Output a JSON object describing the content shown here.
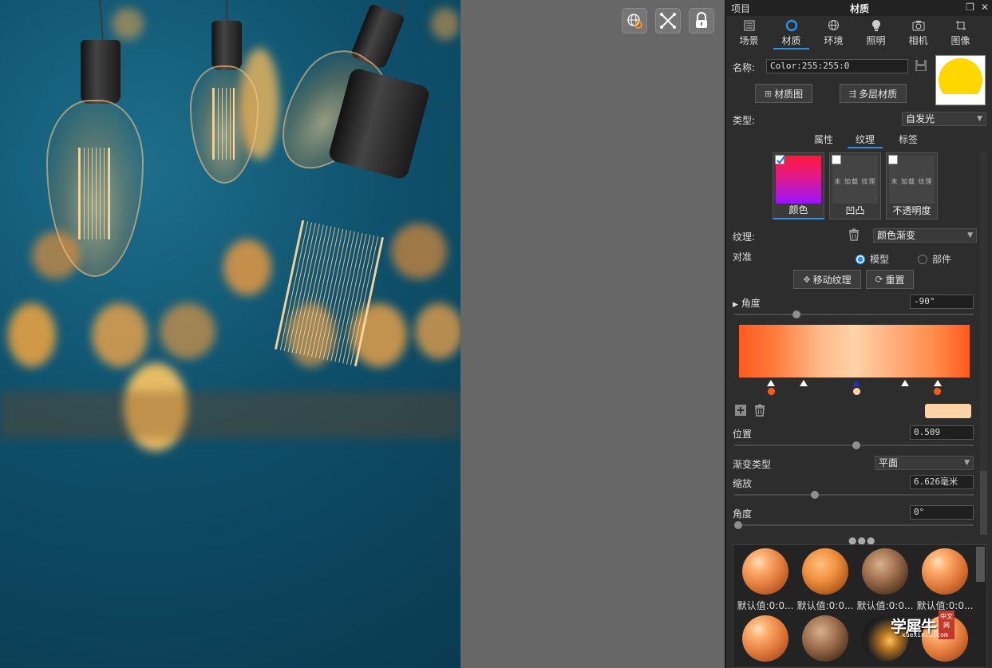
{
  "panel": {
    "project_label": "项目",
    "title": "材质",
    "tabs": [
      {
        "label": "场景",
        "icon": "scene-icon"
      },
      {
        "label": "材质",
        "icon": "material-icon"
      },
      {
        "label": "环境",
        "icon": "environment-icon"
      },
      {
        "label": "照明",
        "icon": "lighting-icon"
      },
      {
        "label": "相机",
        "icon": "camera-icon"
      },
      {
        "label": "图像",
        "icon": "image-icon"
      }
    ],
    "active_tab": "材质"
  },
  "material": {
    "name_label": "名称:",
    "name_value": "Color:255:255:0",
    "preview_color": "#ffd700",
    "graph_button": "材质图",
    "multilayer_button": "多层材质",
    "type_label": "类型:",
    "type_value": "自发光"
  },
  "sub_tabs": [
    "属性",
    "纹理",
    "标签"
  ],
  "active_sub_tab": "纹理",
  "texture_slots": [
    {
      "label": "颜色",
      "checked": true,
      "empty_text": ""
    },
    {
      "label": "凹凸",
      "checked": false,
      "empty_text": "未 加载 纹理"
    },
    {
      "label": "不透明度",
      "checked": false,
      "empty_text": "未 加载 纹理"
    }
  ],
  "texture": {
    "label": "纹理:",
    "value": "颜色渐变",
    "align_label": "对准",
    "align_options": [
      "模型",
      "部件"
    ],
    "align_selected": "模型",
    "move_button": "移动纹理",
    "reset_button": "重置",
    "angle_label": "角度",
    "angle_value": "-90°",
    "angle_slider": 0.25
  },
  "gradient": {
    "stops": [
      {
        "position": 0.14,
        "color": "#ff5a1e"
      },
      {
        "position": 0.509,
        "color": "#ffd3a6",
        "selected": true
      },
      {
        "position": 0.86,
        "color": "#ff5a1e"
      }
    ],
    "midpoints": [
      0.28,
      0.72
    ],
    "selected_color": "#ffd3a6",
    "position_label": "位置",
    "position_value": "0.509",
    "type_label": "渐变类型",
    "type_value": "平面",
    "scale_label": "缩放",
    "scale_value": "6.626毫米",
    "scale_slider": 0.33,
    "angle_label": "角度",
    "angle_value": "0°",
    "angle_slider": 0.0
  },
  "library": {
    "items": [
      {
        "label": "默认值:0:0...",
        "style": "glossy-orange"
      },
      {
        "label": "默认值:0:0...",
        "style": "satin-orange"
      },
      {
        "label": "默认值:0:0...",
        "style": "metal-flake"
      },
      {
        "label": "默认值:0:0...",
        "style": "glossy-orange"
      },
      {
        "label": "",
        "style": "glossy-orange"
      },
      {
        "label": "",
        "style": "metal-flake"
      },
      {
        "label": "",
        "style": "dark-flake"
      },
      {
        "label": "",
        "style": "glossy-orange"
      }
    ]
  },
  "watermark": {
    "main": "学犀牛",
    "sub": "xuexiniu.com",
    "seal": "中文网"
  },
  "colors": {
    "accent": "#2b8ee8",
    "panel_bg": "#2d2d2d",
    "viewport_bg": "#676767"
  }
}
